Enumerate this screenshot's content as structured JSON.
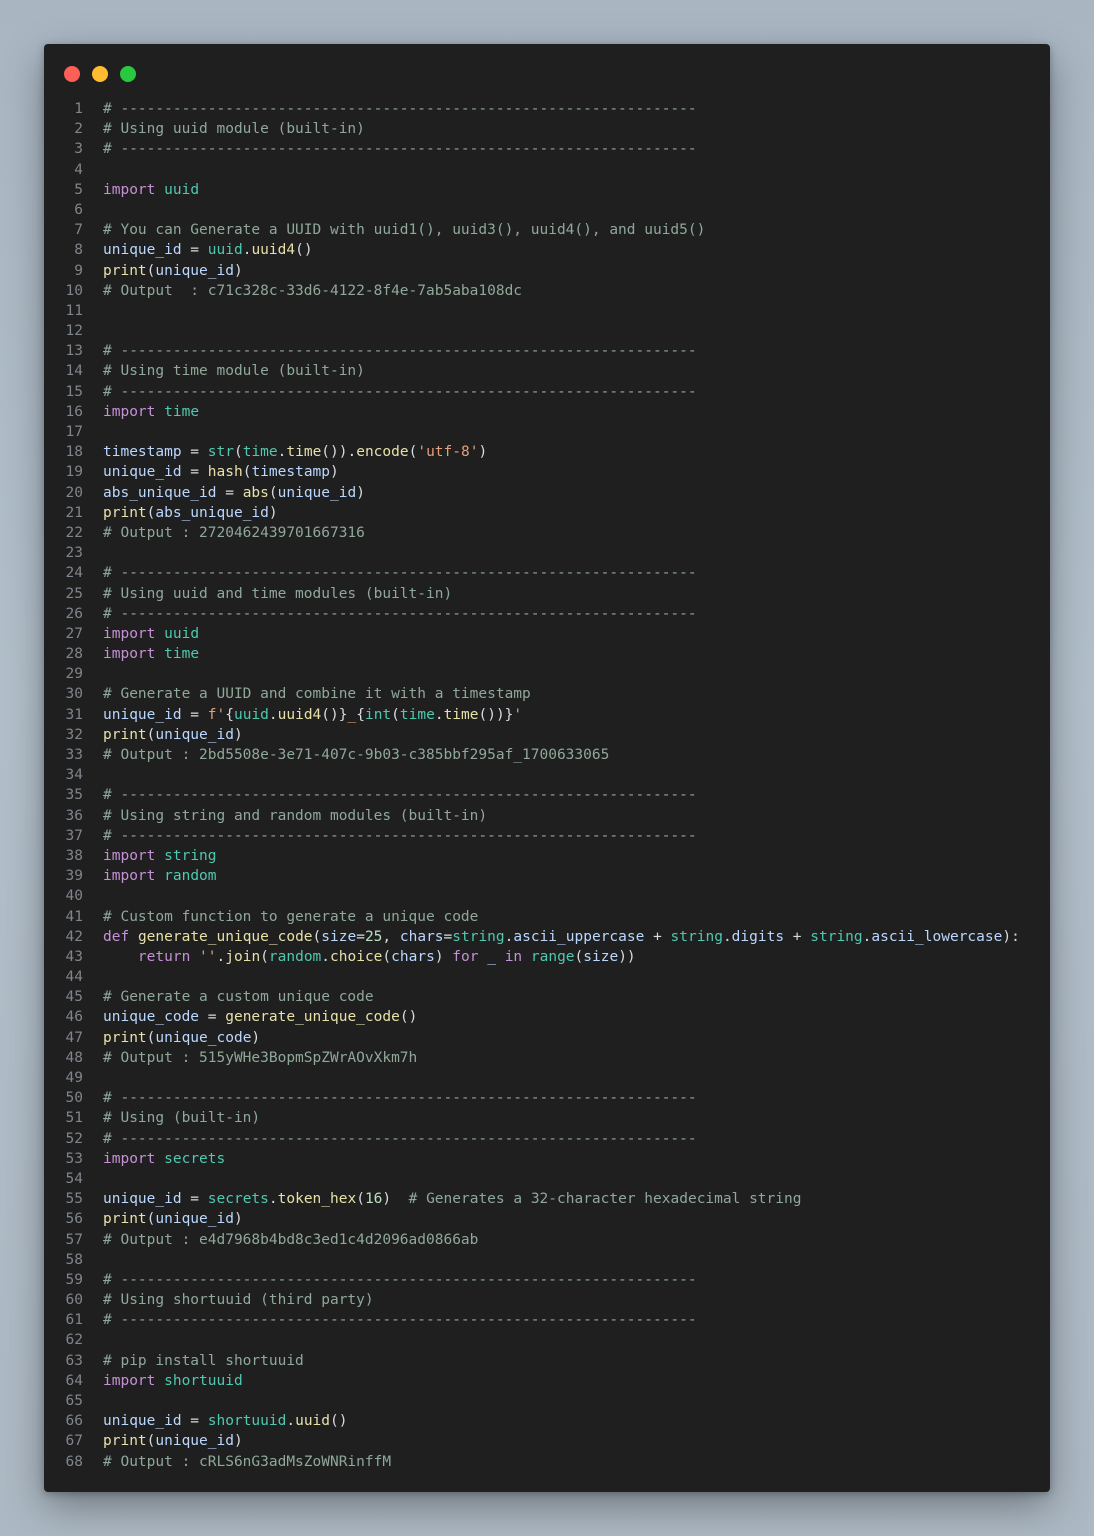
{
  "window": {
    "controls": [
      "close",
      "minimize",
      "maximize"
    ],
    "colors": {
      "close": "#fe5f57",
      "minimize": "#febc2e",
      "maximize": "#28c840",
      "background": "#1f1f1f"
    }
  },
  "code_lines": [
    {
      "n": "1",
      "tokens": [
        [
          "comment",
          "# ------------------------------------------------------------------"
        ]
      ]
    },
    {
      "n": "2",
      "tokens": [
        [
          "comment",
          "# Using uuid module (built-in)"
        ]
      ]
    },
    {
      "n": "3",
      "tokens": [
        [
          "comment",
          "# ------------------------------------------------------------------"
        ]
      ]
    },
    {
      "n": "4",
      "tokens": []
    },
    {
      "n": "5",
      "tokens": [
        [
          "keyword",
          "import"
        ],
        [
          "plain",
          " "
        ],
        [
          "module",
          "uuid"
        ]
      ]
    },
    {
      "n": "6",
      "tokens": []
    },
    {
      "n": "7",
      "tokens": [
        [
          "comment",
          "# You can Generate a UUID with uuid1(), uuid3(), uuid4(), and uuid5()"
        ]
      ]
    },
    {
      "n": "8",
      "tokens": [
        [
          "var",
          "unique_id"
        ],
        [
          "plain",
          " = "
        ],
        [
          "module",
          "uuid"
        ],
        [
          "plain",
          "."
        ],
        [
          "func",
          "uuid4"
        ],
        [
          "plain",
          "()"
        ]
      ]
    },
    {
      "n": "9",
      "tokens": [
        [
          "func",
          "print"
        ],
        [
          "plain",
          "("
        ],
        [
          "var",
          "unique_id"
        ],
        [
          "plain",
          ")"
        ]
      ]
    },
    {
      "n": "10",
      "tokens": [
        [
          "comment",
          "# Output  : c71c328c-33d6-4122-8f4e-7ab5aba108dc"
        ]
      ]
    },
    {
      "n": "11",
      "tokens": []
    },
    {
      "n": "12",
      "tokens": []
    },
    {
      "n": "13",
      "tokens": [
        [
          "comment",
          "# ------------------------------------------------------------------"
        ]
      ]
    },
    {
      "n": "14",
      "tokens": [
        [
          "comment",
          "# Using time module (built-in)"
        ]
      ]
    },
    {
      "n": "15",
      "tokens": [
        [
          "comment",
          "# ------------------------------------------------------------------"
        ]
      ]
    },
    {
      "n": "16",
      "tokens": [
        [
          "keyword",
          "import"
        ],
        [
          "plain",
          " "
        ],
        [
          "module",
          "time"
        ]
      ]
    },
    {
      "n": "17",
      "tokens": []
    },
    {
      "n": "18",
      "tokens": [
        [
          "var",
          "timestamp"
        ],
        [
          "plain",
          " = "
        ],
        [
          "module",
          "str"
        ],
        [
          "plain",
          "("
        ],
        [
          "module",
          "time"
        ],
        [
          "plain",
          "."
        ],
        [
          "func",
          "time"
        ],
        [
          "plain",
          "())."
        ],
        [
          "func",
          "encode"
        ],
        [
          "plain",
          "("
        ],
        [
          "string",
          "'utf-8'"
        ],
        [
          "plain",
          ")"
        ]
      ]
    },
    {
      "n": "19",
      "tokens": [
        [
          "var",
          "unique_id"
        ],
        [
          "plain",
          " = "
        ],
        [
          "func",
          "hash"
        ],
        [
          "plain",
          "("
        ],
        [
          "var",
          "timestamp"
        ],
        [
          "plain",
          ")"
        ]
      ]
    },
    {
      "n": "20",
      "tokens": [
        [
          "var",
          "abs_unique_id"
        ],
        [
          "plain",
          " = "
        ],
        [
          "func",
          "abs"
        ],
        [
          "plain",
          "("
        ],
        [
          "var",
          "unique_id"
        ],
        [
          "plain",
          ")"
        ]
      ]
    },
    {
      "n": "21",
      "tokens": [
        [
          "func",
          "print"
        ],
        [
          "plain",
          "("
        ],
        [
          "var",
          "abs_unique_id"
        ],
        [
          "plain",
          ")"
        ]
      ]
    },
    {
      "n": "22",
      "tokens": [
        [
          "comment",
          "# Output : 2720462439701667316"
        ]
      ]
    },
    {
      "n": "23",
      "tokens": []
    },
    {
      "n": "24",
      "tokens": [
        [
          "comment",
          "# ------------------------------------------------------------------"
        ]
      ]
    },
    {
      "n": "25",
      "tokens": [
        [
          "comment",
          "# Using uuid and time modules (built-in)"
        ]
      ]
    },
    {
      "n": "26",
      "tokens": [
        [
          "comment",
          "# ------------------------------------------------------------------"
        ]
      ]
    },
    {
      "n": "27",
      "tokens": [
        [
          "keyword",
          "import"
        ],
        [
          "plain",
          " "
        ],
        [
          "module",
          "uuid"
        ]
      ]
    },
    {
      "n": "28",
      "tokens": [
        [
          "keyword",
          "import"
        ],
        [
          "plain",
          " "
        ],
        [
          "module",
          "time"
        ]
      ]
    },
    {
      "n": "29",
      "tokens": []
    },
    {
      "n": "30",
      "tokens": [
        [
          "comment",
          "# Generate a UUID and combine it with a timestamp"
        ]
      ]
    },
    {
      "n": "31",
      "tokens": [
        [
          "var",
          "unique_id"
        ],
        [
          "plain",
          " = "
        ],
        [
          "string",
          "f'"
        ],
        [
          "plain",
          "{"
        ],
        [
          "module",
          "uuid"
        ],
        [
          "plain",
          "."
        ],
        [
          "func",
          "uuid4"
        ],
        [
          "plain",
          "()}"
        ],
        [
          "string",
          "_"
        ],
        [
          "plain",
          "{"
        ],
        [
          "module",
          "int"
        ],
        [
          "plain",
          "("
        ],
        [
          "module",
          "time"
        ],
        [
          "plain",
          "."
        ],
        [
          "func",
          "time"
        ],
        [
          "plain",
          "())}"
        ],
        [
          "string",
          "'"
        ]
      ]
    },
    {
      "n": "32",
      "tokens": [
        [
          "func",
          "print"
        ],
        [
          "plain",
          "("
        ],
        [
          "var",
          "unique_id"
        ],
        [
          "plain",
          ")"
        ]
      ]
    },
    {
      "n": "33",
      "tokens": [
        [
          "comment",
          "# Output : 2bd5508e-3e71-407c-9b03-c385bbf295af_1700633065"
        ]
      ]
    },
    {
      "n": "34",
      "tokens": []
    },
    {
      "n": "35",
      "tokens": [
        [
          "comment",
          "# ------------------------------------------------------------------"
        ]
      ]
    },
    {
      "n": "36",
      "tokens": [
        [
          "comment",
          "# Using string and random modules (built-in)"
        ]
      ]
    },
    {
      "n": "37",
      "tokens": [
        [
          "comment",
          "# ------------------------------------------------------------------"
        ]
      ]
    },
    {
      "n": "38",
      "tokens": [
        [
          "keyword",
          "import"
        ],
        [
          "plain",
          " "
        ],
        [
          "module",
          "string"
        ]
      ]
    },
    {
      "n": "39",
      "tokens": [
        [
          "keyword",
          "import"
        ],
        [
          "plain",
          " "
        ],
        [
          "module",
          "random"
        ]
      ]
    },
    {
      "n": "40",
      "tokens": []
    },
    {
      "n": "41",
      "tokens": [
        [
          "comment",
          "# Custom function to generate a unique code"
        ]
      ]
    },
    {
      "n": "42",
      "tokens": [
        [
          "keyword",
          "def"
        ],
        [
          "plain",
          " "
        ],
        [
          "func",
          "generate_unique_code"
        ],
        [
          "plain",
          "("
        ],
        [
          "var",
          "size"
        ],
        [
          "plain",
          "="
        ],
        [
          "number",
          "25"
        ],
        [
          "plain",
          ", "
        ],
        [
          "var",
          "chars"
        ],
        [
          "plain",
          "="
        ],
        [
          "module",
          "string"
        ],
        [
          "plain",
          "."
        ],
        [
          "var",
          "ascii_uppercase"
        ],
        [
          "plain",
          " + "
        ],
        [
          "module",
          "string"
        ],
        [
          "plain",
          "."
        ],
        [
          "var",
          "digits"
        ],
        [
          "plain",
          " + "
        ],
        [
          "module",
          "string"
        ],
        [
          "plain",
          "."
        ],
        [
          "var",
          "ascii_lowercase"
        ],
        [
          "plain",
          "):"
        ]
      ]
    },
    {
      "n": "43",
      "tokens": [
        [
          "plain",
          "    "
        ],
        [
          "keyword",
          "return"
        ],
        [
          "plain",
          " "
        ],
        [
          "string",
          "''"
        ],
        [
          "plain",
          "."
        ],
        [
          "func",
          "join"
        ],
        [
          "plain",
          "("
        ],
        [
          "module",
          "random"
        ],
        [
          "plain",
          "."
        ],
        [
          "func",
          "choice"
        ],
        [
          "plain",
          "("
        ],
        [
          "var",
          "chars"
        ],
        [
          "plain",
          ") "
        ],
        [
          "keyword",
          "for"
        ],
        [
          "plain",
          " "
        ],
        [
          "var",
          "_"
        ],
        [
          "plain",
          " "
        ],
        [
          "keyword",
          "in"
        ],
        [
          "plain",
          " "
        ],
        [
          "module",
          "range"
        ],
        [
          "plain",
          "("
        ],
        [
          "var",
          "size"
        ],
        [
          "plain",
          "))"
        ]
      ]
    },
    {
      "n": "44",
      "tokens": []
    },
    {
      "n": "45",
      "tokens": [
        [
          "comment",
          "# Generate a custom unique code"
        ]
      ]
    },
    {
      "n": "46",
      "tokens": [
        [
          "var",
          "unique_code"
        ],
        [
          "plain",
          " = "
        ],
        [
          "func",
          "generate_unique_code"
        ],
        [
          "plain",
          "()"
        ]
      ]
    },
    {
      "n": "47",
      "tokens": [
        [
          "func",
          "print"
        ],
        [
          "plain",
          "("
        ],
        [
          "var",
          "unique_code"
        ],
        [
          "plain",
          ")"
        ]
      ]
    },
    {
      "n": "48",
      "tokens": [
        [
          "comment",
          "# Output : 515yWHe3BopmSpZWrAOvXkm7h"
        ]
      ]
    },
    {
      "n": "49",
      "tokens": []
    },
    {
      "n": "50",
      "tokens": [
        [
          "comment",
          "# ------------------------------------------------------------------"
        ]
      ]
    },
    {
      "n": "51",
      "tokens": [
        [
          "comment",
          "# Using (built-in)"
        ]
      ]
    },
    {
      "n": "52",
      "tokens": [
        [
          "comment",
          "# ------------------------------------------------------------------"
        ]
      ]
    },
    {
      "n": "53",
      "tokens": [
        [
          "keyword",
          "import"
        ],
        [
          "plain",
          " "
        ],
        [
          "module",
          "secrets"
        ]
      ]
    },
    {
      "n": "54",
      "tokens": []
    },
    {
      "n": "55",
      "tokens": [
        [
          "var",
          "unique_id"
        ],
        [
          "plain",
          " = "
        ],
        [
          "module",
          "secrets"
        ],
        [
          "plain",
          "."
        ],
        [
          "func",
          "token_hex"
        ],
        [
          "plain",
          "("
        ],
        [
          "number",
          "16"
        ],
        [
          "plain",
          ")  "
        ],
        [
          "comment",
          "# Generates a 32-character hexadecimal string"
        ]
      ]
    },
    {
      "n": "56",
      "tokens": [
        [
          "func",
          "print"
        ],
        [
          "plain",
          "("
        ],
        [
          "var",
          "unique_id"
        ],
        [
          "plain",
          ")"
        ]
      ]
    },
    {
      "n": "57",
      "tokens": [
        [
          "comment",
          "# Output : e4d7968b4bd8c3ed1c4d2096ad0866ab"
        ]
      ]
    },
    {
      "n": "58",
      "tokens": []
    },
    {
      "n": "59",
      "tokens": [
        [
          "comment",
          "# ------------------------------------------------------------------"
        ]
      ]
    },
    {
      "n": "60",
      "tokens": [
        [
          "comment",
          "# Using shortuuid (third party)"
        ]
      ]
    },
    {
      "n": "61",
      "tokens": [
        [
          "comment",
          "# ------------------------------------------------------------------"
        ]
      ]
    },
    {
      "n": "62",
      "tokens": []
    },
    {
      "n": "63",
      "tokens": [
        [
          "comment",
          "# pip install shortuuid"
        ]
      ]
    },
    {
      "n": "64",
      "tokens": [
        [
          "keyword",
          "import"
        ],
        [
          "plain",
          " "
        ],
        [
          "module",
          "shortuuid"
        ]
      ]
    },
    {
      "n": "65",
      "tokens": []
    },
    {
      "n": "66",
      "tokens": [
        [
          "var",
          "unique_id"
        ],
        [
          "plain",
          " = "
        ],
        [
          "module",
          "shortuuid"
        ],
        [
          "plain",
          "."
        ],
        [
          "func",
          "uuid"
        ],
        [
          "plain",
          "()"
        ]
      ]
    },
    {
      "n": "67",
      "tokens": [
        [
          "func",
          "print"
        ],
        [
          "plain",
          "("
        ],
        [
          "var",
          "unique_id"
        ],
        [
          "plain",
          ")"
        ]
      ]
    },
    {
      "n": "68",
      "tokens": [
        [
          "comment",
          "# Output : cRLS6nG3adMsZoWNRinffM"
        ]
      ]
    }
  ]
}
